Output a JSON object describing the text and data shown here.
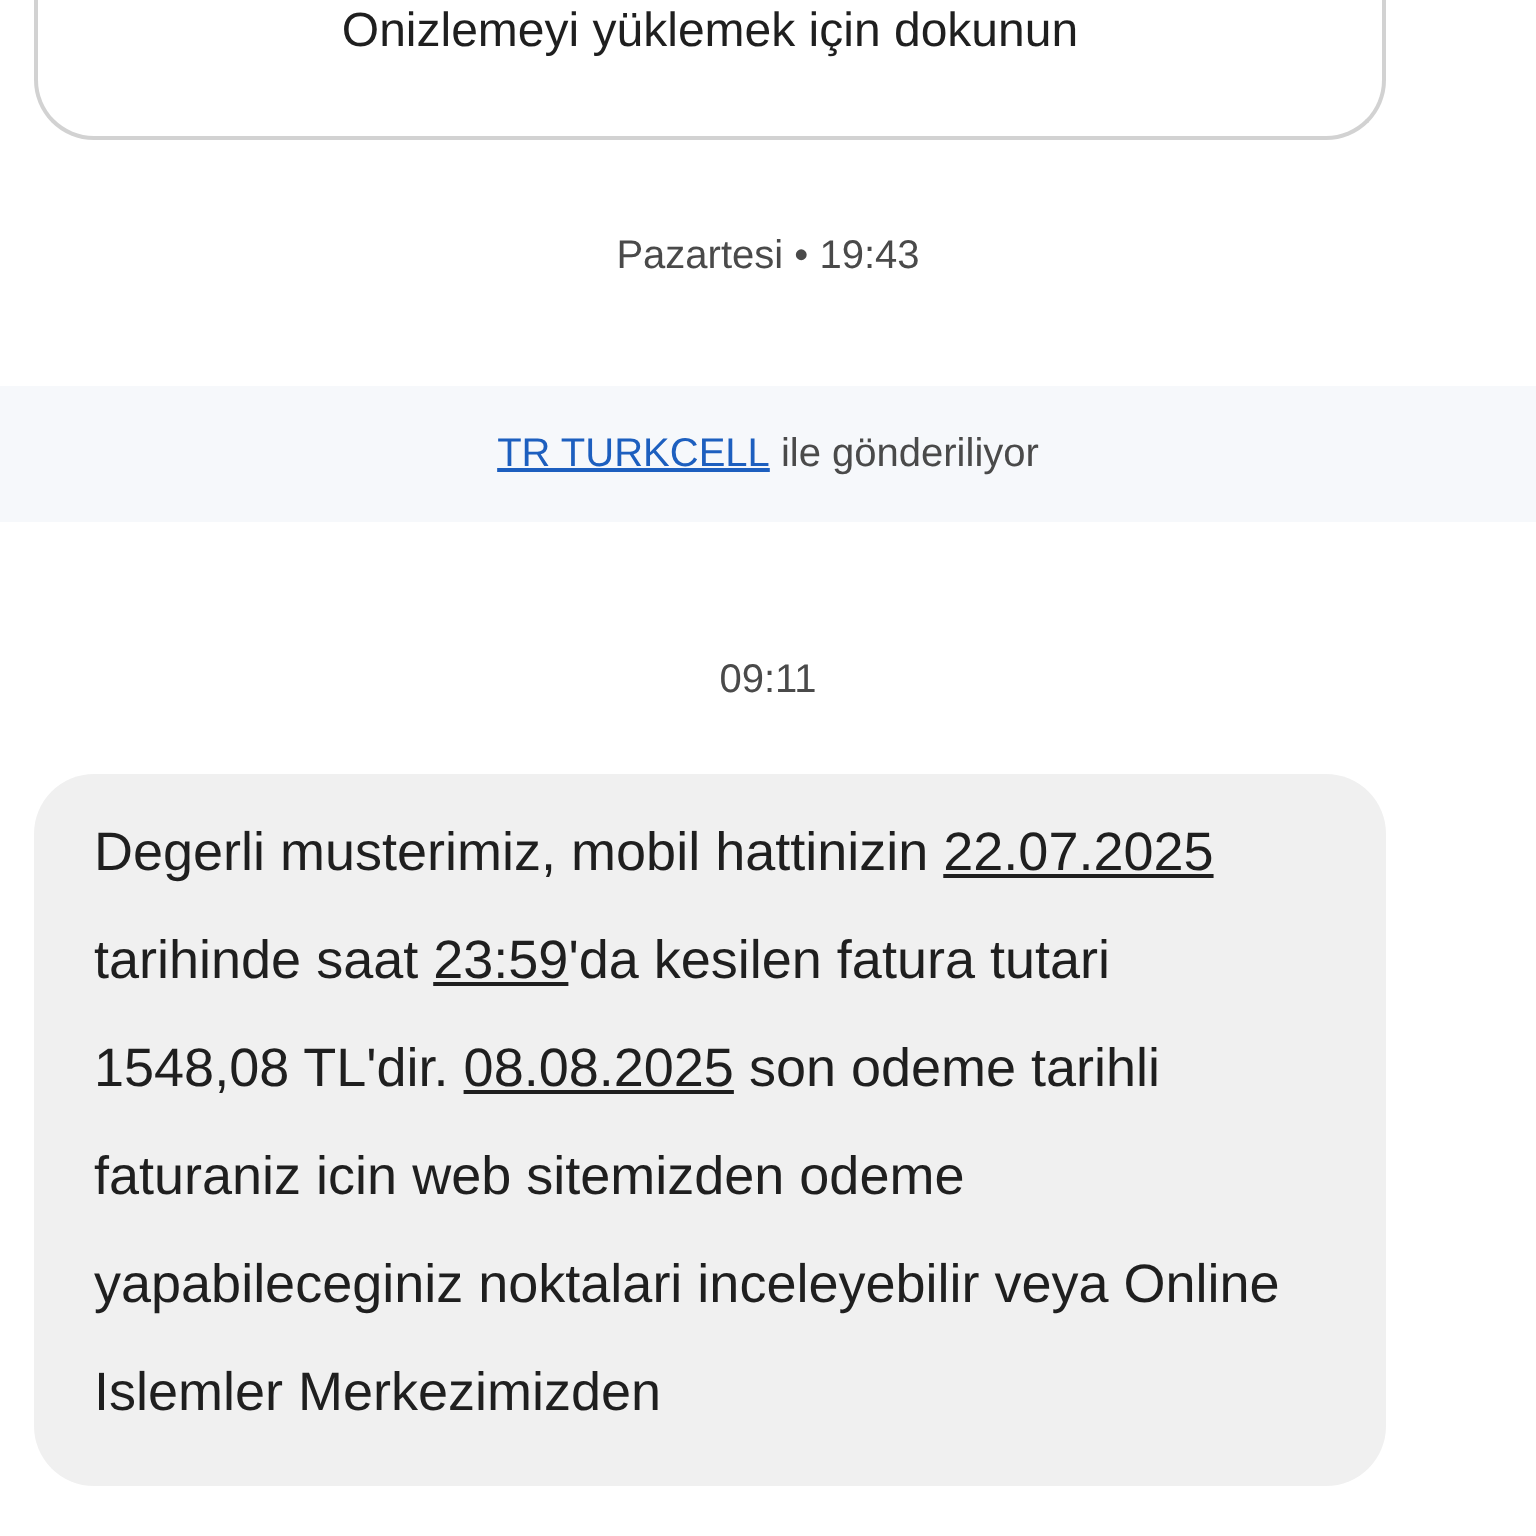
{
  "preview_card": {
    "text": "Onizlemeyi yüklemek için dokunun"
  },
  "timestamp_1": "Pazartesi • 19:43",
  "sender_banner": {
    "sender": "TR TURKCELL",
    "text": "ile gönderiliyor"
  },
  "timestamp_2": "09:11",
  "message": [
    {
      "kind": "text",
      "text": "Degerli musterimiz, mobil hattinizin "
    },
    {
      "kind": "link",
      "text": "22.07.2025"
    },
    {
      "kind": "text",
      "text": " tarihinde saat "
    },
    {
      "kind": "link",
      "text": "23:59"
    },
    {
      "kind": "text",
      "text": "'da kesilen fatura tutari 1548,08 TL'dir. "
    },
    {
      "kind": "link",
      "text": "08.08.2025"
    },
    {
      "kind": "text",
      "text": " son odeme tarihli faturaniz icin web sitemizden odeme yapabileceginiz noktalari inceleyebilir veya Online Islemler Merkezimizden"
    }
  ]
}
